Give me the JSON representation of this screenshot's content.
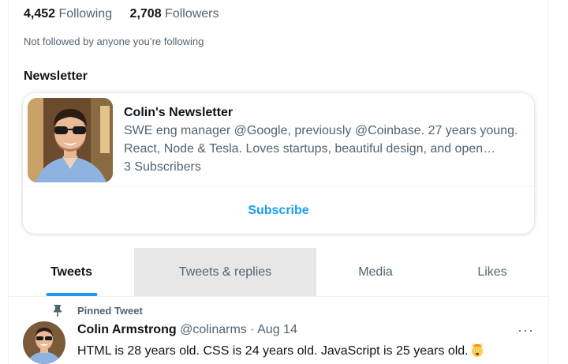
{
  "profile": {
    "following_count": "4,452",
    "following_label": "Following",
    "followers_count": "2,708",
    "followers_label": "Followers",
    "not_followed_text": "Not followed by anyone you’re following"
  },
  "newsletter": {
    "heading": "Newsletter",
    "title": "Colin's Newsletter",
    "description": "SWE eng manager @Google, previously @Coinbase. 27 years young. React, Node & Tesla. Loves startups, beautiful design, and open source.",
    "subscribers": "3 Subscribers",
    "subscribe_label": "Subscribe"
  },
  "tabs": [
    {
      "label": "Tweets",
      "active": true
    },
    {
      "label": "Tweets & replies",
      "active": false
    },
    {
      "label": "Media",
      "active": false
    },
    {
      "label": "Likes",
      "active": false
    }
  ],
  "tweet": {
    "pinned_label": "Pinned Tweet",
    "author_name": "Colin Armstrong",
    "handle": "@colinarms",
    "separator": "·",
    "date": "Aug 14",
    "more_label": "···",
    "text": "HTML is 28 years old. CSS is 24 years old. JavaScript is 25 years old.",
    "emoji": "exploding-head"
  },
  "colors": {
    "accent": "#1d9bf0",
    "text_primary": "#0f1419",
    "text_secondary": "#536471",
    "tab_hover_bg": "#e7e7e8"
  }
}
